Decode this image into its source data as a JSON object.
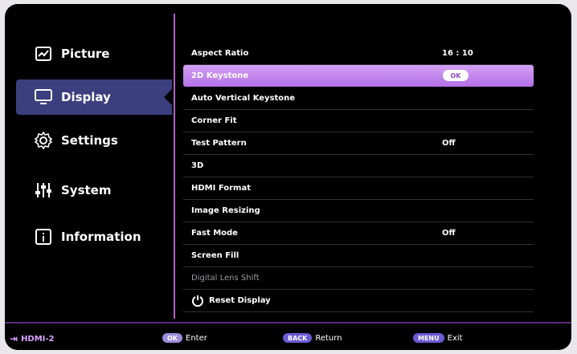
{
  "sidebar": {
    "items": [
      {
        "label": "Picture",
        "icon": "picture-icon"
      },
      {
        "label": "Display",
        "icon": "display-icon"
      },
      {
        "label": "Settings",
        "icon": "gear-icon"
      },
      {
        "label": "System",
        "icon": "sliders-icon"
      },
      {
        "label": "Information",
        "icon": "info-icon"
      }
    ],
    "active_index": 1
  },
  "menu": {
    "rows": [
      {
        "label": "Aspect Ratio",
        "value": "16 : 10"
      },
      {
        "label": "2D Keystone",
        "value": "OK"
      },
      {
        "label": "Auto Vertical Keystone",
        "value": ""
      },
      {
        "label": "Corner Fit",
        "value": ""
      },
      {
        "label": "Test Pattern",
        "value": "Off"
      },
      {
        "label": "3D",
        "value": ""
      },
      {
        "label": "HDMI Format",
        "value": ""
      },
      {
        "label": "Image Resizing",
        "value": ""
      },
      {
        "label": "Fast Mode",
        "value": "Off"
      },
      {
        "label": "Screen Fill",
        "value": ""
      },
      {
        "label": "Digital Lens Shift",
        "value": ""
      },
      {
        "label": "Reset Display",
        "value": ""
      }
    ],
    "active_index": 1
  },
  "bottom": {
    "source": "HDMI-2",
    "hints": [
      {
        "key": "OK",
        "label": "Enter"
      },
      {
        "key": "BACK",
        "label": "Return"
      },
      {
        "key": "MENU",
        "label": "Exit"
      }
    ]
  },
  "colors": {
    "accent": "#b471e8",
    "sidebar_active": "#3b3f7e",
    "divider": "#b064c8"
  }
}
